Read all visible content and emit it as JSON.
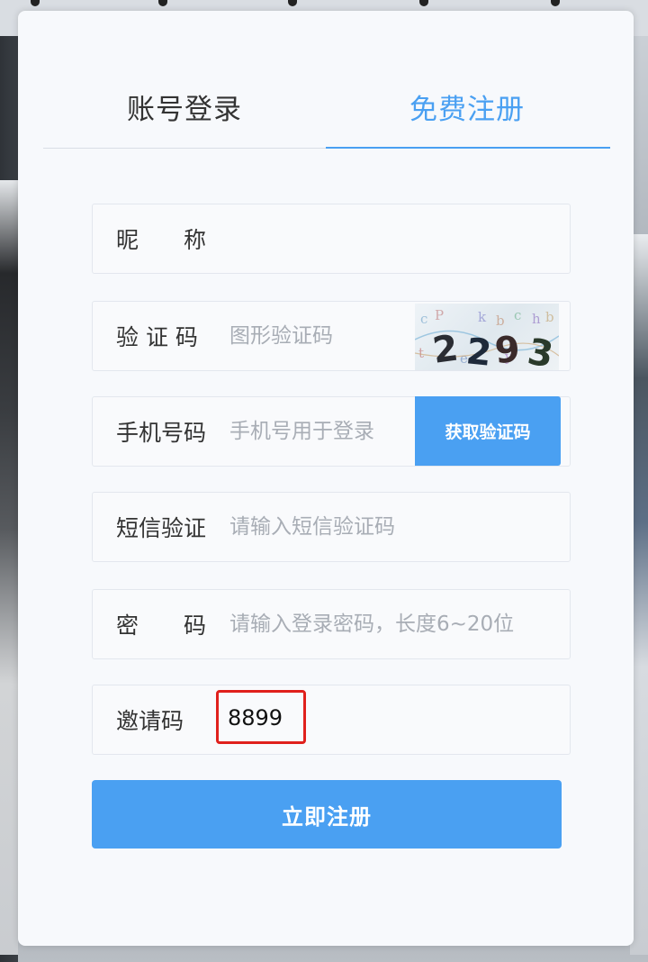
{
  "tabs": {
    "login": "账号登录",
    "register": "免费注册",
    "active": "register"
  },
  "form": {
    "nickname": {
      "label": "昵　　称",
      "value": "",
      "placeholder": ""
    },
    "captcha": {
      "label": "验 证 码",
      "placeholder": "图形验证码",
      "image_text": "2293"
    },
    "phone": {
      "label": "手机号码",
      "placeholder": "手机号用于登录",
      "button": "获取验证码"
    },
    "sms_code": {
      "label": "短信验证",
      "placeholder": "请输入短信验证码"
    },
    "password": {
      "label": "密　　码",
      "placeholder": "请输入登录密码，长度6~20位"
    },
    "invite": {
      "label": "邀请码",
      "value": "8899"
    }
  },
  "submit_label": "立即注册",
  "colors": {
    "accent": "#4aa0f2",
    "highlight": "#e0201c",
    "card": "#f7f9fc"
  }
}
